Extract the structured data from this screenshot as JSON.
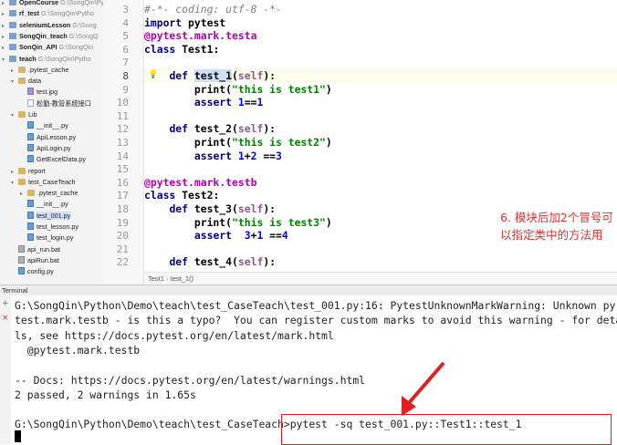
{
  "project_tree": [
    {
      "name": "OpenCourse",
      "path": "G:\\SongQin\\Pytho",
      "kind": "folder-blue",
      "indent": 0,
      "bold": true
    },
    {
      "name": "rf_test",
      "path": "G:\\SongQin\\Pytho",
      "kind": "folder-blue",
      "indent": 0,
      "bold": true
    },
    {
      "name": "seleniumLesson",
      "path": "G:\\Song",
      "kind": "folder-blue",
      "indent": 0,
      "bold": true
    },
    {
      "name": "SongQin_teach",
      "path": "G:\\SongQ",
      "kind": "folder-blue",
      "indent": 0,
      "bold": true
    },
    {
      "name": "SonQin_API",
      "path": "G:\\SongQin",
      "kind": "folder-blue",
      "indent": 0,
      "bold": true
    },
    {
      "name": "teach",
      "path": "G:\\SongQin\\Pytho",
      "kind": "folder-blue",
      "indent": 0,
      "bold": true,
      "open": true
    },
    {
      "name": ".pytest_cache",
      "path": "",
      "kind": "folder",
      "indent": 1
    },
    {
      "name": "data",
      "path": "",
      "kind": "folder",
      "indent": 1,
      "open": true
    },
    {
      "name": "test.jpg",
      "path": "",
      "kind": "img",
      "indent": 2
    },
    {
      "name": "松勤-教管系统接口",
      "path": "",
      "kind": "file",
      "indent": 2
    },
    {
      "name": "Lib",
      "path": "",
      "kind": "folder",
      "indent": 1,
      "open": true
    },
    {
      "name": "__init__.py",
      "path": "",
      "kind": "py",
      "indent": 2
    },
    {
      "name": "ApiLesson.py",
      "path": "",
      "kind": "py",
      "indent": 2
    },
    {
      "name": "ApiLogin.py",
      "path": "",
      "kind": "py",
      "indent": 2
    },
    {
      "name": "GetExcelData.py",
      "path": "",
      "kind": "py",
      "indent": 2
    },
    {
      "name": "report",
      "path": "",
      "kind": "folder",
      "indent": 1
    },
    {
      "name": "test_CaseTeach",
      "path": "",
      "kind": "folder",
      "indent": 1,
      "open": true
    },
    {
      "name": ".pytest_cache",
      "path": "",
      "kind": "folder",
      "indent": 2
    },
    {
      "name": "__init__.py",
      "path": "",
      "kind": "py",
      "indent": 2
    },
    {
      "name": "test_001.py",
      "path": "",
      "kind": "py",
      "indent": 2,
      "selected": true
    },
    {
      "name": "test_lesson.py",
      "path": "",
      "kind": "py",
      "indent": 2
    },
    {
      "name": "test_login.py",
      "path": "",
      "kind": "py",
      "indent": 2
    },
    {
      "name": "api_run.bat",
      "path": "",
      "kind": "bat",
      "indent": 1
    },
    {
      "name": "apiRun.bat",
      "path": "",
      "kind": "bat",
      "indent": 1
    },
    {
      "name": "config.py",
      "path": "",
      "kind": "py",
      "indent": 1
    }
  ],
  "editor": {
    "line_numbers": [
      "3",
      "4",
      "5",
      "6",
      "7",
      "8",
      "9",
      "10",
      "11",
      "12",
      "13",
      "14",
      "15",
      "16",
      "17",
      "18",
      "19",
      "20",
      "21",
      "22"
    ],
    "current_line": "8",
    "code_lines": [
      [
        {
          "t": "#-*- coding: utf-8 -*-",
          "c": "cmt"
        }
      ],
      [
        {
          "t": "import",
          "c": "kw"
        },
        {
          "t": " pytest"
        }
      ],
      [
        {
          "t": "@pytest.mark.testa",
          "c": "dec"
        }
      ],
      [
        {
          "t": "class",
          "c": "kw"
        },
        {
          "t": " Test1:"
        }
      ],
      [],
      [
        {
          "t": "    "
        },
        {
          "t": "def",
          "c": "kw"
        },
        {
          "t": " "
        },
        {
          "t": "test_1",
          "c": "fnhl"
        },
        {
          "t": "("
        },
        {
          "t": "self",
          "c": "slf"
        },
        {
          "t": "):"
        }
      ],
      [
        {
          "t": "        print("
        },
        {
          "t": "\"this is test1\"",
          "c": "str"
        },
        {
          "t": ")"
        }
      ],
      [
        {
          "t": "        "
        },
        {
          "t": "assert",
          "c": "kw"
        },
        {
          "t": " "
        },
        {
          "t": "1",
          "c": "num"
        },
        {
          "t": "=="
        },
        {
          "t": "1",
          "c": "num"
        }
      ],
      [],
      [
        {
          "t": "    "
        },
        {
          "t": "def",
          "c": "kw"
        },
        {
          "t": " test_2("
        },
        {
          "t": "self",
          "c": "slf"
        },
        {
          "t": "):"
        }
      ],
      [
        {
          "t": "        print("
        },
        {
          "t": "\"this is test2\"",
          "c": "str"
        },
        {
          "t": ")"
        }
      ],
      [
        {
          "t": "        "
        },
        {
          "t": "assert",
          "c": "kw"
        },
        {
          "t": " "
        },
        {
          "t": "1",
          "c": "num"
        },
        {
          "t": "+"
        },
        {
          "t": "2",
          "c": "num"
        },
        {
          "t": " =="
        },
        {
          "t": "3",
          "c": "num"
        }
      ],
      [],
      [
        {
          "t": "@pytest.mark.testb",
          "c": "dec"
        }
      ],
      [
        {
          "t": "class",
          "c": "kw"
        },
        {
          "t": " Test2:"
        }
      ],
      [
        {
          "t": "    "
        },
        {
          "t": "def",
          "c": "kw"
        },
        {
          "t": " test_3("
        },
        {
          "t": "self",
          "c": "slf"
        },
        {
          "t": "):"
        }
      ],
      [
        {
          "t": "        print("
        },
        {
          "t": "\"this is test3\"",
          "c": "str"
        },
        {
          "t": ")"
        }
      ],
      [
        {
          "t": "        "
        },
        {
          "t": "assert",
          "c": "kw"
        },
        {
          "t": "  "
        },
        {
          "t": "3",
          "c": "num"
        },
        {
          "t": "+"
        },
        {
          "t": "1",
          "c": "num"
        },
        {
          "t": " =="
        },
        {
          "t": "4",
          "c": "num"
        }
      ],
      [],
      [
        {
          "t": "    "
        },
        {
          "t": "def",
          "c": "kw"
        },
        {
          "t": " test_4("
        },
        {
          "t": "self",
          "c": "slf"
        },
        {
          "t": "):"
        }
      ]
    ],
    "annotation": "6. 模块后加2个冒号可以指定类中的方法用",
    "breadcrumb": [
      "Test1",
      "test_1()"
    ]
  },
  "terminal": {
    "title": "Terminal",
    "side_icons": [
      "+",
      "×"
    ],
    "lines": [
      "G:\\SongQin\\Python\\Demo\\teach\\test_CaseTeach\\test_001.py:16: PytestUnknownMarkWarning: Unknown py",
      "test.mark.testb - is this a typo?  You can register custom marks to avoid this warning - for detai",
      "ls, see https://docs.pytest.org/en/latest/mark.html",
      "  @pytest.mark.testb",
      "",
      "-- Docs: https://docs.pytest.org/en/latest/warnings.html",
      "2 passed, 2 warnings in 1.65s",
      "",
      "G:\\SongQin\\Python\\Demo\\teach\\test_CaseTeach>pytest -sq test_001.py::Test1::test_1"
    ]
  },
  "colors": {
    "annotation": "#e03030",
    "arrow": "#e02020",
    "keyword": "#000080",
    "decorator": "#b200b2",
    "string": "#008000"
  }
}
